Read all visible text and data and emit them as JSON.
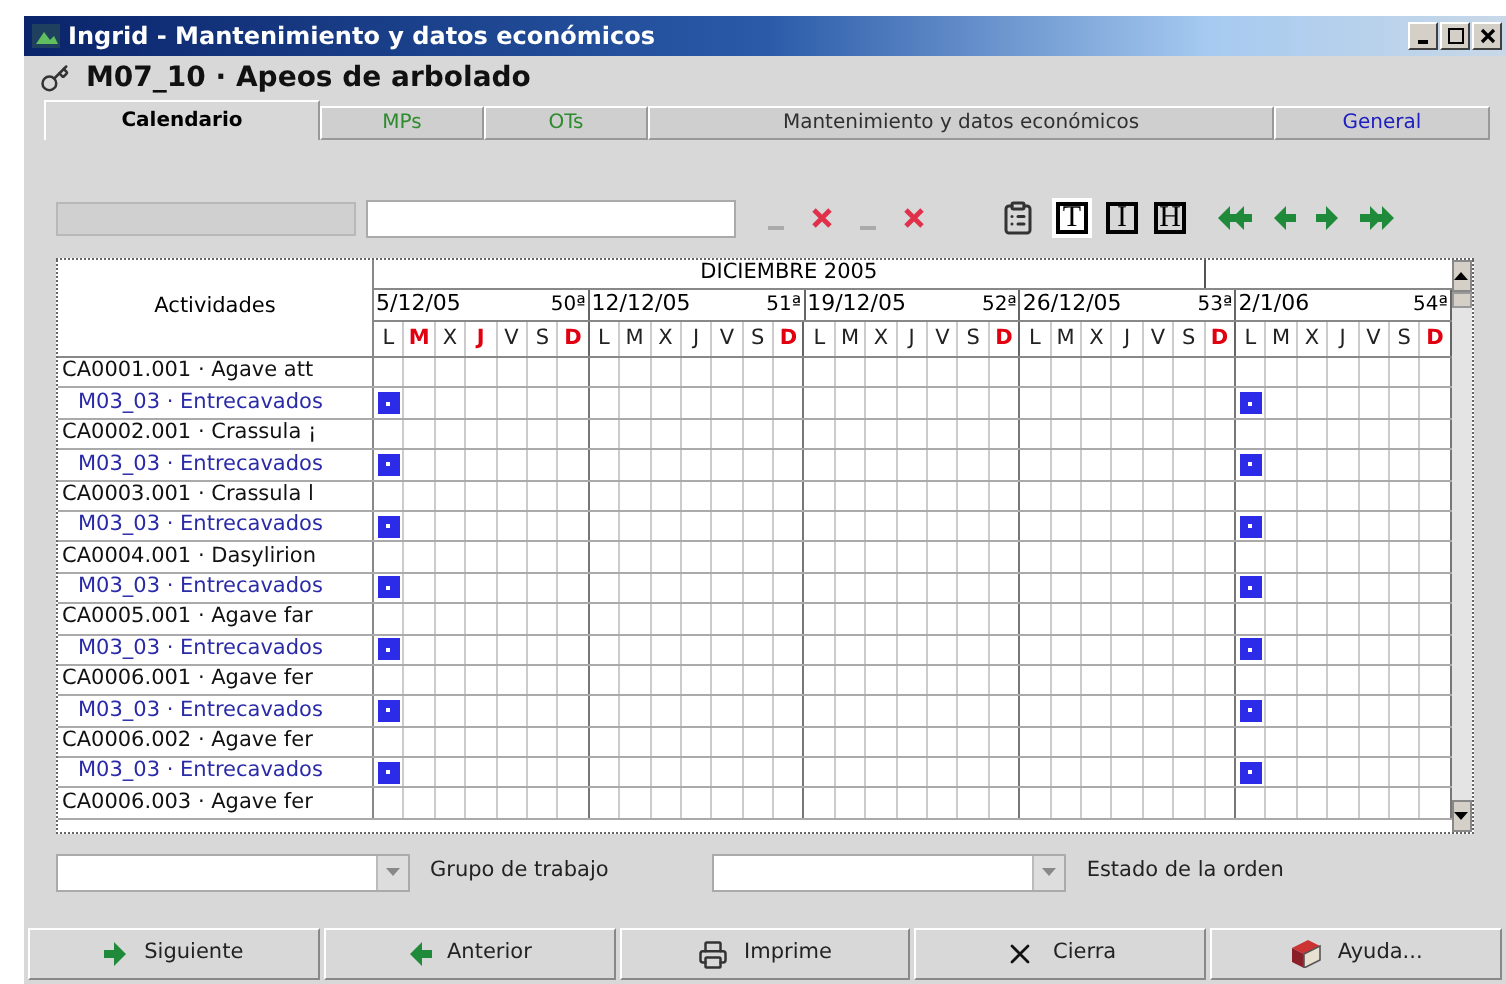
{
  "window": {
    "title": "Ingrid - Mantenimiento y datos económicos"
  },
  "form_title": "M07_10 · Apeos de arbolado",
  "tabs": [
    {
      "label": "Calendario",
      "selected": true,
      "color": "#000000"
    },
    {
      "label": "MPs",
      "selected": false,
      "color": "#2e8b2e"
    },
    {
      "label": "OTs",
      "selected": false,
      "color": "#2e8b2e"
    },
    {
      "label": "Mantenimiento y datos económicos",
      "selected": false,
      "color": "#303030"
    },
    {
      "label": "General",
      "selected": false,
      "color": "#2020c0"
    }
  ],
  "toolbar": {
    "view_buttons": [
      {
        "label": "T",
        "selected": true
      },
      {
        "label": "I",
        "selected": false
      },
      {
        "label": "H",
        "selected": false
      }
    ]
  },
  "calendar": {
    "header": "Actividades",
    "month": "DICIEMBRE 2005",
    "weeks": [
      {
        "date": "5/12/05",
        "number": "50ª",
        "days": [
          {
            "label": "L",
            "holiday": false,
            "marked": true
          },
          {
            "label": "M",
            "holiday": true,
            "marked": false
          },
          {
            "label": "X",
            "holiday": false,
            "marked": false
          },
          {
            "label": "J",
            "holiday": true,
            "marked": false
          },
          {
            "label": "V",
            "holiday": false,
            "marked": false
          },
          {
            "label": "S",
            "holiday": false,
            "marked": false
          },
          {
            "label": "D",
            "holiday": true,
            "marked": false
          }
        ]
      },
      {
        "date": "12/12/05",
        "number": "51ª",
        "days": [
          {
            "label": "L",
            "holiday": false,
            "marked": false
          },
          {
            "label": "M",
            "holiday": false,
            "marked": false
          },
          {
            "label": "X",
            "holiday": false,
            "marked": false
          },
          {
            "label": "J",
            "holiday": false,
            "marked": false
          },
          {
            "label": "V",
            "holiday": false,
            "marked": false
          },
          {
            "label": "S",
            "holiday": false,
            "marked": false
          },
          {
            "label": "D",
            "holiday": true,
            "marked": false
          }
        ]
      },
      {
        "date": "19/12/05",
        "number": "52ª",
        "days": [
          {
            "label": "L",
            "holiday": false,
            "marked": false
          },
          {
            "label": "M",
            "holiday": false,
            "marked": false
          },
          {
            "label": "X",
            "holiday": false,
            "marked": false
          },
          {
            "label": "J",
            "holiday": false,
            "marked": false
          },
          {
            "label": "V",
            "holiday": false,
            "marked": false
          },
          {
            "label": "S",
            "holiday": false,
            "marked": false
          },
          {
            "label": "D",
            "holiday": true,
            "marked": false
          }
        ]
      },
      {
        "date": "26/12/05",
        "number": "53ª",
        "days": [
          {
            "label": "L",
            "holiday": false,
            "marked": false
          },
          {
            "label": "M",
            "holiday": false,
            "marked": false
          },
          {
            "label": "X",
            "holiday": false,
            "marked": false
          },
          {
            "label": "J",
            "holiday": false,
            "marked": false
          },
          {
            "label": "V",
            "holiday": false,
            "marked": false
          },
          {
            "label": "S",
            "holiday": false,
            "marked": false
          },
          {
            "label": "D",
            "holiday": true,
            "marked": false
          }
        ]
      },
      {
        "date": "2/1/06",
        "number": "54ª",
        "days": [
          {
            "label": "L",
            "holiday": false,
            "marked": true
          },
          {
            "label": "M",
            "holiday": false,
            "marked": false
          },
          {
            "label": "X",
            "holiday": false,
            "marked": false
          },
          {
            "label": "J",
            "holiday": false,
            "marked": false
          },
          {
            "label": "V",
            "holiday": false,
            "marked": false
          },
          {
            "label": "S",
            "holiday": false,
            "marked": false
          },
          {
            "label": "D",
            "holiday": true,
            "marked": false
          }
        ]
      }
    ],
    "rows": [
      {
        "label": "CA0001.001 · Agave att",
        "kind": "activity",
        "scheduled": false
      },
      {
        "label": "M03_03 · Entrecavados",
        "kind": "maintenance",
        "scheduled": true
      },
      {
        "label": "CA0002.001 · Crassula ¡",
        "kind": "activity",
        "scheduled": false
      },
      {
        "label": "M03_03 · Entrecavados",
        "kind": "maintenance",
        "scheduled": true
      },
      {
        "label": "CA0003.001 · Crassula l",
        "kind": "activity",
        "scheduled": false
      },
      {
        "label": "M03_03 · Entrecavados",
        "kind": "maintenance",
        "scheduled": true
      },
      {
        "label": "CA0004.001 · Dasylirion",
        "kind": "activity",
        "scheduled": false
      },
      {
        "label": "M03_03 · Entrecavados",
        "kind": "maintenance",
        "scheduled": true
      },
      {
        "label": "CA0005.001 · Agave far",
        "kind": "activity",
        "scheduled": false
      },
      {
        "label": "M03_03 · Entrecavados",
        "kind": "maintenance",
        "scheduled": true
      },
      {
        "label": "CA0006.001 · Agave fer",
        "kind": "activity",
        "scheduled": false
      },
      {
        "label": "M03_03 · Entrecavados",
        "kind": "maintenance",
        "scheduled": true
      },
      {
        "label": "CA0006.002 · Agave fer",
        "kind": "activity",
        "scheduled": false
      },
      {
        "label": "M03_03 · Entrecavados",
        "kind": "maintenance",
        "scheduled": true
      },
      {
        "label": "CA0006.003 · Agave fer",
        "kind": "activity",
        "scheduled": false
      }
    ]
  },
  "filters": [
    {
      "label": "Grupo de trabajo"
    },
    {
      "label": "Estado de la orden"
    }
  ],
  "buttons": [
    {
      "label": "Siguiente",
      "kind": "next"
    },
    {
      "label": "Anterior",
      "kind": "previous"
    },
    {
      "label": "Imprime",
      "kind": "print"
    },
    {
      "label": "Cierra",
      "kind": "close"
    },
    {
      "label": "Ayuda...",
      "kind": "help"
    }
  ]
}
